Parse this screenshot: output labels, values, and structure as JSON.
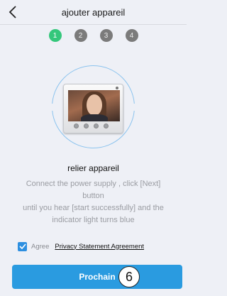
{
  "header": {
    "title": "ajouter appareil",
    "back_icon": "chevron-left-icon"
  },
  "steps": [
    "1",
    "2",
    "3",
    "4"
  ],
  "active_step": 1,
  "colors": {
    "accent": "#2a9be0",
    "active_step": "#34c77b",
    "inactive_step": "#7b7b7b",
    "background": "#eef0f6"
  },
  "main": {
    "heading": "relier appareil",
    "description_lines": [
      "Connect the power supply , click [Next]",
      "button",
      "until you hear [start successfully] and the",
      "indicator light turns blue"
    ]
  },
  "agreement": {
    "checked": true,
    "label": "Agree",
    "link_text": "Privacy Statement Agreement"
  },
  "footer": {
    "next_label": "Prochain",
    "badge_number": "6"
  }
}
